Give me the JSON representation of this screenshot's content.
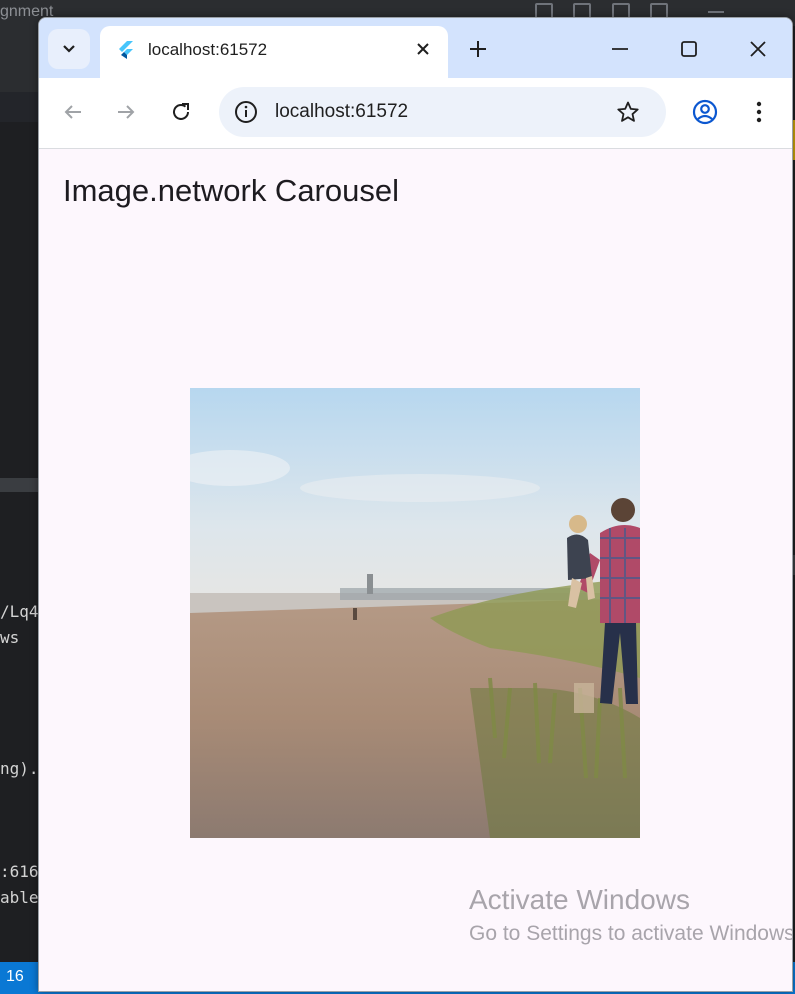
{
  "ide": {
    "top_fragment": "gnment",
    "code_lines": [
      "/Lq4",
      "ws",
      "ng).",
      ":616",
      "able"
    ],
    "status_text": "16"
  },
  "browser": {
    "tab_title": "localhost:61572",
    "url": "localhost:61572",
    "icons": {
      "tab_search": "chevron-down-icon",
      "favicon": "flutter-icon",
      "close": "close-icon",
      "new_tab": "plus-icon",
      "minimize": "minimize-icon",
      "maximize": "maximize-icon",
      "window_close": "close-icon",
      "back": "arrow-left-icon",
      "forward": "arrow-right-icon",
      "reload": "reload-icon",
      "site_info": "info-icon",
      "bookmark": "star-icon",
      "profile": "profile-icon",
      "menu": "more-vertical-icon"
    },
    "colors": {
      "tab_strip": "#d3e3fd",
      "page_background": "#fdf7fd",
      "accent": "#0b57d0"
    }
  },
  "app": {
    "title": "Image.network Carousel",
    "image_alt": "Father carrying child walking on a beach path"
  },
  "watermark": {
    "title": "Activate Windows",
    "subtitle": "Go to Settings to activate Windows."
  }
}
